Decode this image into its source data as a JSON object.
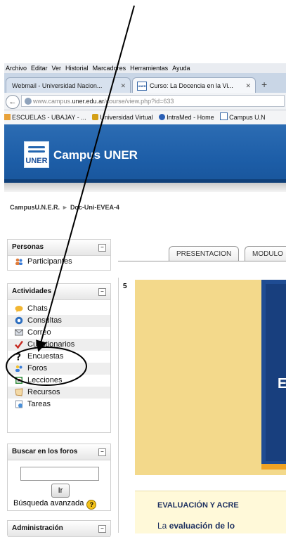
{
  "browser": {
    "menu": [
      {
        "label": "Archivo"
      },
      {
        "label": "Editar"
      },
      {
        "label": "Ver"
      },
      {
        "label": "Historial"
      },
      {
        "label": "Marcadores"
      },
      {
        "label": "Herramientas"
      },
      {
        "label": "Ayuda"
      }
    ],
    "tabs": [
      {
        "label": "Webmail - Universidad Nacion...",
        "active": false
      },
      {
        "label": "Curso: La Docencia en la Vi...",
        "active": true
      }
    ],
    "new_tab": "+",
    "url_prefix": "www.campus.",
    "url_domain": "uner.edu.ar",
    "url_path": "/course/view.php?id=633",
    "bookmarks": [
      {
        "label": "ESCUELAS - UBAJAY - ..."
      },
      {
        "label": "Universidad Virtual"
      },
      {
        "label": "IntraMed - Home"
      },
      {
        "label": "Campus U.N"
      }
    ]
  },
  "site": {
    "logo_text": "UNER",
    "title": "Campus UNER",
    "breadcrumb": {
      "root": "CampusU.N.E.R.",
      "separator": "►",
      "current": "Doc-Uni-EVEA-4"
    }
  },
  "blocks": {
    "personas": {
      "title": "Personas",
      "items": [
        {
          "label": "Participantes"
        }
      ]
    },
    "actividades": {
      "title": "Actividades",
      "items": [
        {
          "label": "Chats"
        },
        {
          "label": "Consultas"
        },
        {
          "label": "Correo"
        },
        {
          "label": "Cuestionarios"
        },
        {
          "label": "Encuestas"
        },
        {
          "label": "Foros"
        },
        {
          "label": "Lecciones"
        },
        {
          "label": "Recursos"
        },
        {
          "label": "Tareas"
        }
      ]
    },
    "buscar": {
      "title": "Buscar en los foros",
      "button": "Ir",
      "advanced": "Búsqueda avanzada"
    },
    "admin": {
      "title": "Administración"
    }
  },
  "course": {
    "tabs": [
      {
        "label": "PRESENTACION"
      },
      {
        "label": "MODULO"
      }
    ],
    "topic_number": "5",
    "banner_letter": "E",
    "eval_title": "EVALUACIÓN Y ACRE",
    "eval_text_prefix": "La",
    "eval_text_bold": "evaluación de lo"
  },
  "colors": {
    "header_blue": "#1d5ea8",
    "banner_yellow": "#f3d98b",
    "annotation": "#000000"
  }
}
